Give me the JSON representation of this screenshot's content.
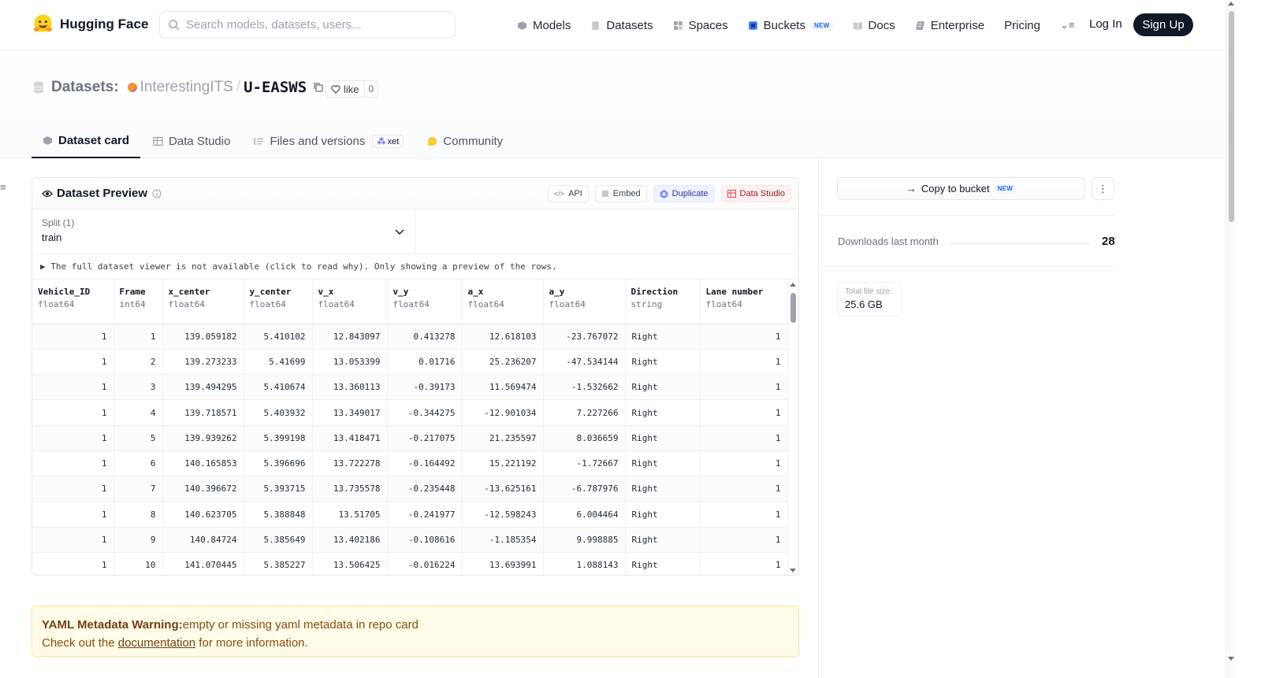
{
  "brand": {
    "name": "Hugging Face"
  },
  "search": {
    "placeholder": "Search models, datasets, users..."
  },
  "nav": {
    "models": "Models",
    "datasets": "Datasets",
    "spaces": "Spaces",
    "buckets": "Buckets",
    "buckets_badge": "NEW",
    "docs": "Docs",
    "enterprise": "Enterprise",
    "pricing": "Pricing",
    "more": "⌄≡",
    "login": "Log In",
    "signup": "Sign Up"
  },
  "breadcrumb": {
    "section": "Datasets:",
    "org": "InterestingITS",
    "separator": "/",
    "repo": "U-EASWS"
  },
  "like": {
    "label": "like",
    "count": "0"
  },
  "tabs": {
    "card": "Dataset card",
    "studio": "Data Studio",
    "files": "Files and versions",
    "xet": "xet",
    "community": "Community"
  },
  "preview": {
    "title": "Dataset Preview",
    "actions": {
      "api": "API",
      "embed": "Embed",
      "duplicate": "Duplicate",
      "studio": "Data Studio"
    },
    "split_label": "Split (1)",
    "split_value": "train",
    "notice": "▶ The full dataset viewer is not available (click to read why). Only showing a preview of the rows.",
    "columns": [
      {
        "name": "Vehicle_ID",
        "type": "float64"
      },
      {
        "name": "Frame",
        "type": "int64"
      },
      {
        "name": "x_center",
        "type": "float64"
      },
      {
        "name": "y_center",
        "type": "float64"
      },
      {
        "name": "v_x",
        "type": "float64"
      },
      {
        "name": "v_y",
        "type": "float64"
      },
      {
        "name": "a_x",
        "type": "float64"
      },
      {
        "name": "a_y",
        "type": "float64"
      },
      {
        "name": "Direction",
        "type": "string"
      },
      {
        "name": "Lane number",
        "type": "float64"
      }
    ],
    "rows": [
      [
        "1",
        "1",
        "139.059182",
        "5.410102",
        "12.843097",
        "0.413278",
        "12.618103",
        "-23.767072",
        "Right",
        "1"
      ],
      [
        "1",
        "2",
        "139.273233",
        "5.41699",
        "13.053399",
        "0.01716",
        "25.236207",
        "-47.534144",
        "Right",
        "1"
      ],
      [
        "1",
        "3",
        "139.494295",
        "5.410674",
        "13.360113",
        "-0.39173",
        "11.569474",
        "-1.532662",
        "Right",
        "1"
      ],
      [
        "1",
        "4",
        "139.718571",
        "5.403932",
        "13.349017",
        "-0.344275",
        "-12.901034",
        "7.227266",
        "Right",
        "1"
      ],
      [
        "1",
        "5",
        "139.939262",
        "5.399198",
        "13.418471",
        "-0.217075",
        "21.235597",
        "8.036659",
        "Right",
        "1"
      ],
      [
        "1",
        "6",
        "140.165853",
        "5.396696",
        "13.722278",
        "-0.164492",
        "15.221192",
        "-1.72667",
        "Right",
        "1"
      ],
      [
        "1",
        "7",
        "140.396672",
        "5.393715",
        "13.735578",
        "-0.235448",
        "-13.625161",
        "-6.787976",
        "Right",
        "1"
      ],
      [
        "1",
        "8",
        "140.623705",
        "5.388848",
        "13.51705",
        "-0.241977",
        "-12.598243",
        "6.004464",
        "Right",
        "1"
      ],
      [
        "1",
        "9",
        "140.84724",
        "5.385649",
        "13.402186",
        "-0.108616",
        "-1.185354",
        "9.998885",
        "Right",
        "1"
      ],
      [
        "1",
        "10",
        "141.070445",
        "5.385227",
        "13.506425",
        "-0.016224",
        "13.693991",
        "1.088143",
        "Right",
        "1"
      ]
    ]
  },
  "warning": {
    "title": "YAML Metadata Warning:",
    "message": "empty or missing yaml metadata in repo card",
    "line2_prefix": "Check out the ",
    "link": "documentation",
    "line2_suffix": " for more information."
  },
  "sidebar": {
    "copy_bucket": "Copy to bucket",
    "copy_bucket_badge": "NEW",
    "downloads_label": "Downloads last month",
    "downloads_value": "28",
    "size_label": "Total file size:",
    "size_value": "25.6 GB"
  },
  "colors": {
    "accent": "#111827",
    "warning_bg": "#fefce8",
    "new_badge": "#2563eb"
  }
}
